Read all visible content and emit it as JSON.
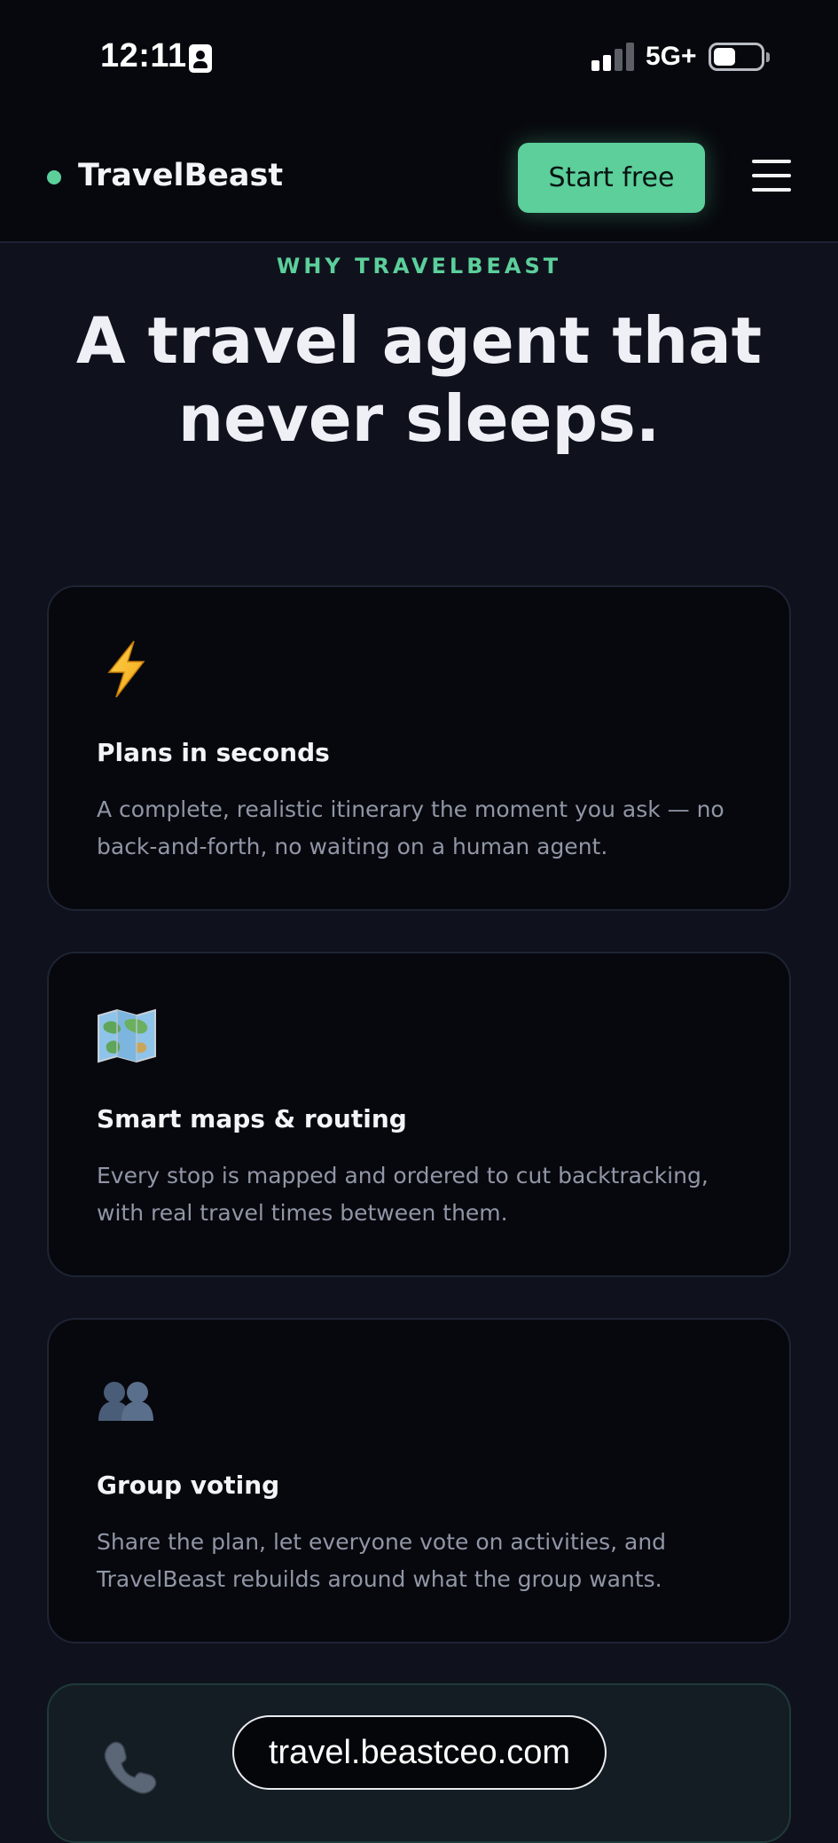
{
  "status_bar": {
    "time": "12:11",
    "network": "5G+",
    "icons": [
      "contact-card-icon",
      "signal-icon",
      "battery-icon"
    ]
  },
  "navbar": {
    "brand": "TravelBeast",
    "cta_label": "Start free",
    "menu_icon": "hamburger-menu-icon"
  },
  "hero": {
    "eyebrow": "WHY TRAVELBEAST",
    "headline_line1": "A travel agent that",
    "headline_line2": "never sleeps."
  },
  "features": [
    {
      "icon": "lightning-icon",
      "title": "Plans in seconds",
      "description": "A complete, realistic itinerary the moment you ask — no back-and-forth, no waiting on a human agent."
    },
    {
      "icon": "map-icon",
      "title": "Smart maps & routing",
      "description": "Every stop is mapped and ordered to cut backtracking, with real travel times between them."
    },
    {
      "icon": "people-icon",
      "title": "Group voting",
      "description": "Share the plan, let everyone vote on activities, and TravelBeast rebuilds around what the group wants."
    }
  ],
  "contact": {
    "icon": "telephone-icon"
  },
  "url_bar": {
    "domain": "travel.beastceo.com"
  },
  "colors": {
    "accent": "#5ccf9b",
    "page_background": "#0f121c",
    "card_background": "#07080d",
    "muted_text": "#9096a6"
  }
}
